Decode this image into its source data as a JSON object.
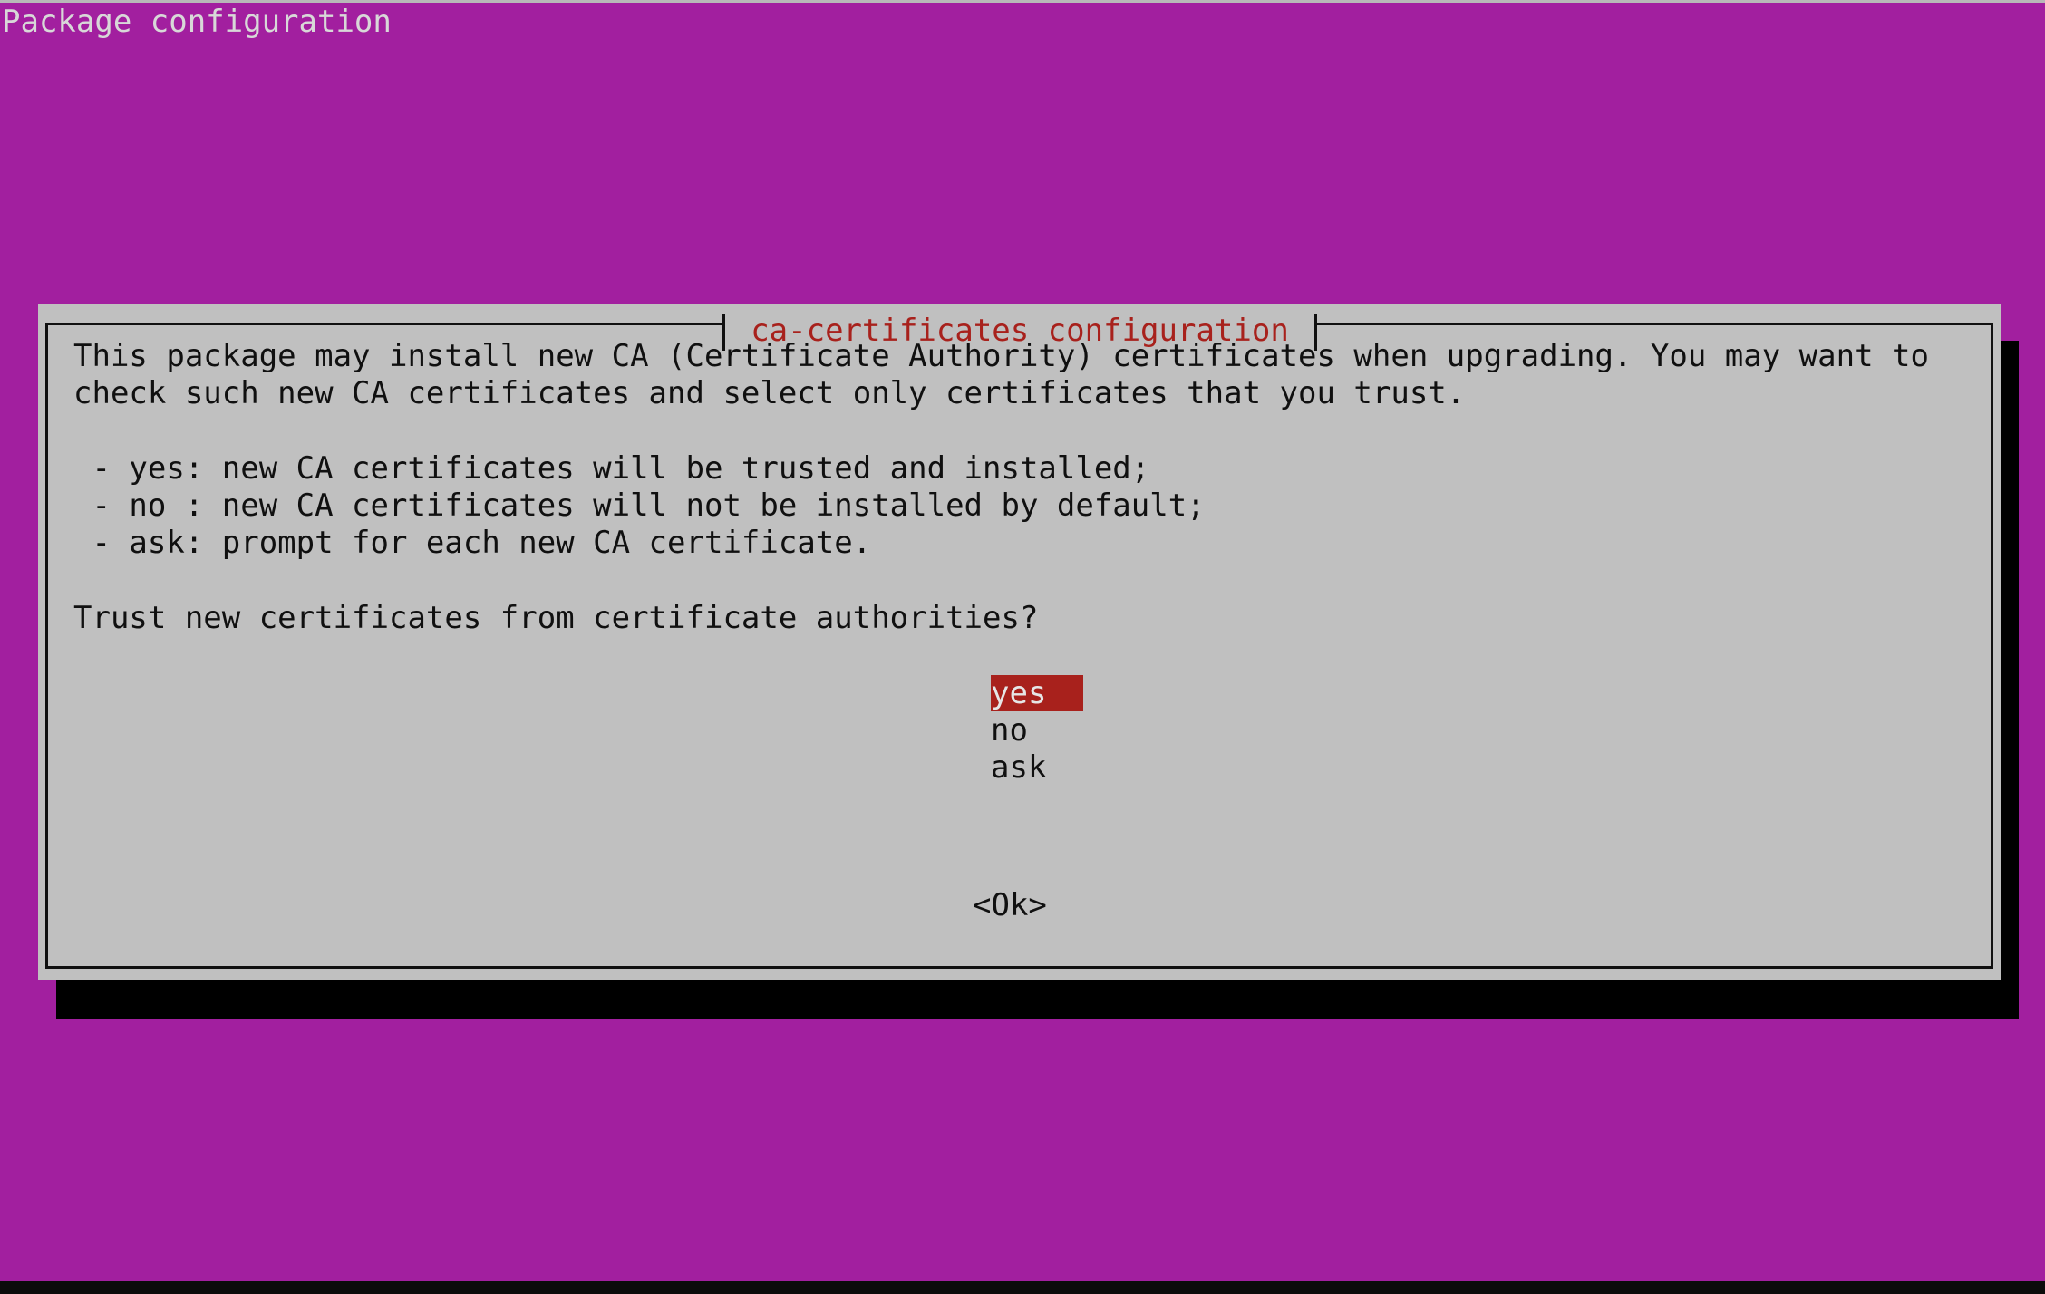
{
  "screen": {
    "backtitle": "Package configuration"
  },
  "dialog": {
    "title": "ca-certificates configuration",
    "intro_lines": [
      "This package may install new CA (Certificate Authority) certificates when upgrading. You may want to",
      "check such new CA certificates and select only certificates that you trust."
    ],
    "option_descriptions": [
      " - yes: new CA certificates will be trusted and installed;",
      " - no : new CA certificates will not be installed by default;",
      " - ask: prompt for each new CA certificate."
    ],
    "question": "Trust new certificates from certificate authorities?",
    "menu": {
      "selected": "yes",
      "options": [
        "yes",
        "no",
        "ask"
      ]
    },
    "ok_label": "<Ok>"
  },
  "colors": {
    "desktop_background": "#a21f9f",
    "dialog_background": "#c0c0c0",
    "title_text": "#a8211c",
    "selection_background": "#a8211c",
    "selection_text": "#e6e6e6",
    "shadow": "#000000"
  }
}
